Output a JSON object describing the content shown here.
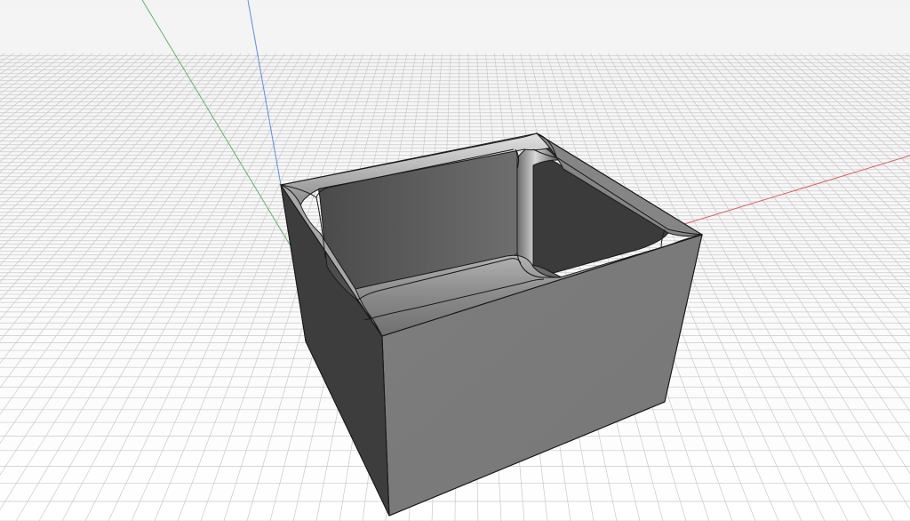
{
  "viewport": {
    "background_top": "#f3f3f3",
    "background_bottom": "#ffffff",
    "grid_color": "#c9c9c9",
    "grid_visible": true
  },
  "axes": {
    "x_color": "#e06060",
    "y_color": "#5fb56f",
    "z_color": "#5b8fe0"
  },
  "model": {
    "shape": "open-box-with-filleted-inner-edges",
    "edge_color": "#1a1a1a",
    "front_face_color": "#7b7b7b",
    "left_face_color": "#3d3d3d",
    "inner_back_color": "#3a3a3a",
    "inner_side_color": "#5e5e5e",
    "floor_color": "#6b6b6b",
    "rim_color": "#9a9a9a"
  }
}
